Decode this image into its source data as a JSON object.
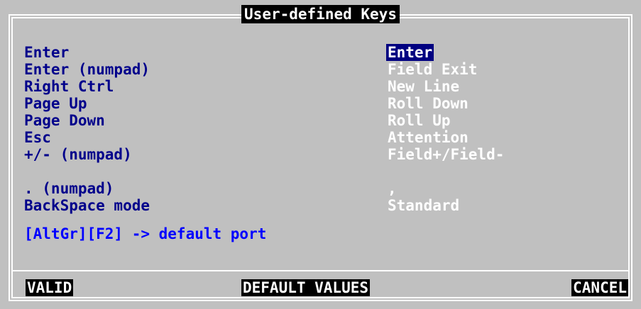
{
  "dialog": {
    "title": "User-defined Keys"
  },
  "mappings": [
    {
      "key": "Enter",
      "value": "Enter",
      "selected": true
    },
    {
      "key": "Enter (numpad)",
      "value": "Field Exit"
    },
    {
      "key": "Right Ctrl",
      "value": "New Line"
    },
    {
      "key": "Page Up",
      "value": "Roll Down"
    },
    {
      "key": "Page Down",
      "value": "Roll Up"
    },
    {
      "key": "Esc",
      "value": "Attention"
    },
    {
      "key": "+/- (numpad)",
      "value": "Field+/Field-"
    },
    {
      "key": ". (numpad)",
      "value": ","
    },
    {
      "key": "BackSpace mode",
      "value": "Standard"
    }
  ],
  "hint": "[AltGr][F2] -> default port",
  "buttons": {
    "valid": "VALID",
    "default_values": "DEFAULT VALUES",
    "cancel": "CANCEL"
  },
  "colors": {
    "background": "#c0c0c0",
    "label": "#00008b",
    "value": "#ffffff",
    "selected_bg": "#000080",
    "hint": "#0000ff"
  }
}
